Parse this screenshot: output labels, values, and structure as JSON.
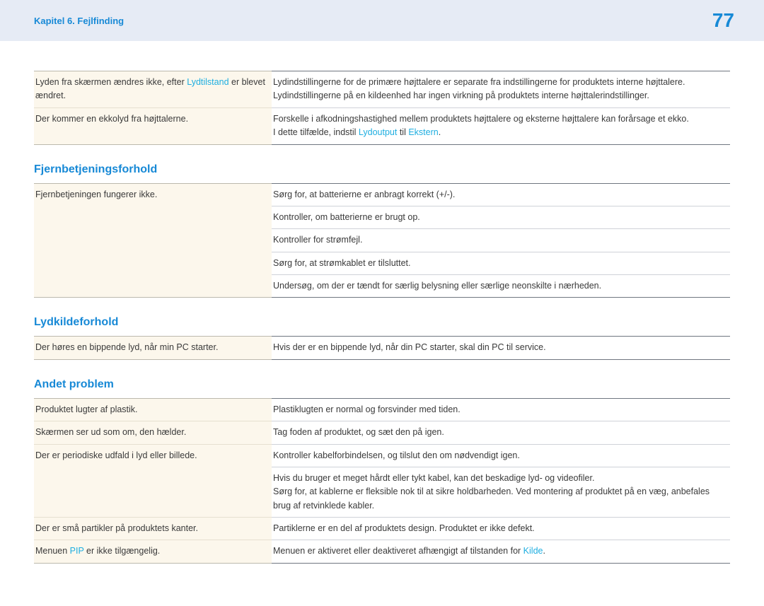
{
  "header": {
    "chapter": "Kapitel 6. Fejlfinding",
    "page": "77"
  },
  "initialRows": [
    {
      "issue": {
        "pre": "Lyden fra skærmen ændres ikke, efter ",
        "hl": "Lydtilstand",
        "post": " er blevet ændret."
      },
      "solutions": [
        "Lydindstillingerne for de primære højttalere er separate fra indstillingerne for produktets interne højttalere.",
        "Lydindstillingerne på en kildeenhed har ingen virkning på produktets interne højttalerindstillinger."
      ]
    },
    {
      "issue": {
        "pre": "Der kommer en ekkolyd fra højttalerne.",
        "hl": "",
        "post": ""
      },
      "solutions": [
        "Forskelle i afkodningshastighed mellem produktets højttalere og eksterne højttalere kan forårsage et ekko."
      ],
      "composite": {
        "pre": "I dette tilfælde, indstil ",
        "hl1": "Lydoutput",
        "mid": " til ",
        "hl2": "Ekstern",
        "post": "."
      }
    }
  ],
  "sections": [
    {
      "heading": "Fjernbetjeningsforhold",
      "rows": [
        {
          "issue": "Fjernbetjeningen fungerer ikke.",
          "solutions": [
            "Sørg for, at batterierne er anbragt korrekt (+/-).",
            "Kontroller, om batterierne er brugt op.",
            "Kontroller for strømfejl.",
            "Sørg for, at strømkablet er tilsluttet.",
            "Undersøg, om der er tændt for særlig belysning eller særlige neonskilte i nærheden."
          ]
        }
      ]
    },
    {
      "heading": "Lydkildeforhold",
      "rows": [
        {
          "issue": "Der høres en bippende lyd, når min PC starter.",
          "solutions": [
            "Hvis der er en bippende lyd, når din PC starter, skal din PC til service."
          ]
        }
      ]
    },
    {
      "heading": "Andet problem",
      "rows": [
        {
          "issue": "Produktet lugter af plastik.",
          "solutions": [
            "Plastiklugten er normal og forsvinder med tiden."
          ]
        },
        {
          "issue": "Skærmen ser ud som om, den hælder.",
          "solutions": [
            "Tag foden af produktet, og sæt den på igen."
          ]
        },
        {
          "issue": "Der er periodiske udfald i lyd eller billede.",
          "solutions": [
            "Kontroller kabelforbindelsen, og tilslut den om nødvendigt igen.",
            "Hvis du bruger et meget hårdt eller tykt kabel, kan det beskadige lyd- og videofiler.",
            "Sørg for, at kablerne er fleksible nok til at sikre holdbarheden. Ved montering af produktet på en væg, anbefales brug af retvinklede kabler."
          ]
        },
        {
          "issue": "Der er små partikler på produktets kanter.",
          "solutions": [
            "Partiklerne er en del af produktets design. Produktet er ikke defekt."
          ]
        }
      ],
      "finalRow": {
        "issue": {
          "pre": "Menuen ",
          "hl": "PIP",
          "post": " er ikke tilgængelig."
        },
        "solution": {
          "pre": "Menuen er aktiveret eller deaktiveret afhængigt af tilstanden for ",
          "hl": "Kilde",
          "post": "."
        }
      }
    }
  ]
}
